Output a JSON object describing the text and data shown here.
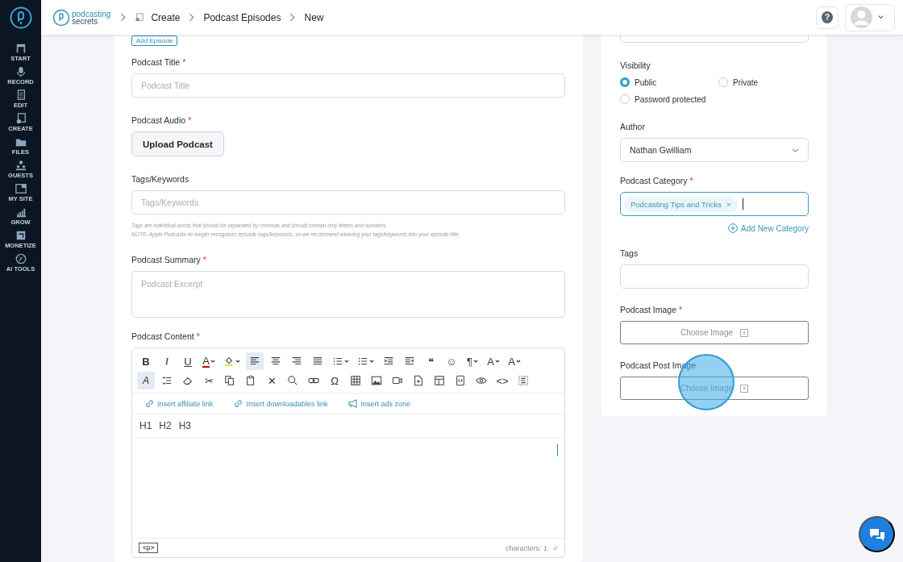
{
  "sidebar": {
    "items": [
      {
        "label": "START",
        "selected": false
      },
      {
        "label": "RECORD",
        "selected": false
      },
      {
        "label": "EDIT",
        "selected": false
      },
      {
        "label": "CREATE",
        "selected": false
      },
      {
        "label": "FILES",
        "selected": false
      },
      {
        "label": "GUESTS",
        "selected": false
      },
      {
        "label": "MY SITE",
        "selected": false
      },
      {
        "label": "GROW",
        "selected": false
      },
      {
        "label": "MONETIZE",
        "selected": false
      },
      {
        "label": "AI TOOLS",
        "selected": false
      }
    ]
  },
  "header": {
    "logo_lines": [
      "podcasting",
      "secrets"
    ],
    "breadcrumb": [
      "Create",
      "Podcast Episodes",
      "New"
    ],
    "help": "?"
  },
  "form": {
    "add_episode": "Add Episode",
    "fields": [
      {
        "kind": "input",
        "label": "Podcast Title",
        "required_mark": "*",
        "placeholder": "Podcast Title"
      },
      {
        "kind": "upload",
        "label": "Podcast Audio",
        "required_mark": "*",
        "button": "Upload Podcast"
      },
      {
        "kind": "input",
        "label": "Tags/Keywords",
        "placeholder": "Tags/Keywords",
        "hints": [
          "Tags are individual words that should be separated by commas and should contain only letters and numbers.",
          "NOTE: Apple Podcasts no longer recognizes episode tags/keywords, so we recommend weaving your tags/keywords into your episode title."
        ]
      },
      {
        "kind": "textarea",
        "label": "Podcast Summary",
        "required_mark": "*",
        "placeholder": "Podcast Excerpt"
      },
      {
        "kind": "editor",
        "label": "Podcast Content",
        "required_mark": "*"
      }
    ]
  },
  "editor": {
    "toolbar": [
      [
        {
          "kind": "bold",
          "glyph": "B",
          "selected": false
        },
        {
          "kind": "italic",
          "glyph": "I",
          "selected": false
        },
        {
          "kind": "underline",
          "glyph": "U",
          "selected": false
        },
        {
          "kind": "font-color",
          "glyph": "A",
          "selected": false,
          "dropdown": true
        },
        {
          "kind": "highlight",
          "selected": false,
          "dropdown": true
        },
        {
          "kind": "align-left",
          "selected": true
        },
        {
          "kind": "align-center",
          "selected": false
        },
        {
          "kind": "align-right",
          "selected": false
        },
        {
          "kind": "justify",
          "selected": false
        },
        {
          "kind": "ordered-list",
          "selected": false,
          "dropdown": true
        },
        {
          "kind": "bullet-list",
          "selected": false,
          "dropdown": true
        },
        {
          "kind": "outdent",
          "selected": false
        },
        {
          "kind": "indent",
          "selected": false
        },
        {
          "kind": "text",
          "glyph": "❝",
          "selected": false
        },
        {
          "kind": "text",
          "glyph": "☺",
          "selected": false
        },
        {
          "kind": "text",
          "glyph": "¶",
          "selected": false,
          "dropdown": true
        },
        {
          "kind": "text",
          "glyph": "A",
          "selected": false,
          "dropdown": true
        },
        {
          "kind": "text",
          "glyph": "A",
          "selected": false,
          "dropdown": true
        }
      ],
      [
        {
          "kind": "font-style",
          "glyph": "A",
          "selected": true
        },
        {
          "kind": "line-height",
          "selected": false
        },
        {
          "kind": "eraser",
          "selected": false
        },
        {
          "kind": "text",
          "glyph": "✂",
          "selected": false
        },
        {
          "kind": "copy",
          "selected": false
        },
        {
          "kind": "paste",
          "selected": false
        },
        {
          "kind": "text",
          "glyph": "✕",
          "selected": false
        },
        {
          "kind": "search",
          "selected": false
        },
        {
          "kind": "link",
          "selected": false
        },
        {
          "kind": "text",
          "glyph": "Ω",
          "selected": false
        },
        {
          "kind": "table",
          "selected": false
        },
        {
          "kind": "image",
          "selected": false
        },
        {
          "kind": "video",
          "selected": false
        },
        {
          "kind": "file",
          "selected": false
        },
        {
          "kind": "template",
          "selected": false
        },
        {
          "kind": "code-block",
          "selected": false
        },
        {
          "kind": "eye",
          "selected": false
        },
        {
          "kind": "text",
          "glyph": "<>",
          "selected": false
        },
        {
          "kind": "select-all",
          "selected": false
        }
      ]
    ],
    "links": [
      {
        "kind": "link",
        "label": "Insert affiliate link"
      },
      {
        "kind": "link",
        "label": "Insert downloadables link"
      },
      {
        "kind": "megaphone",
        "label": "Insert ads zone"
      }
    ],
    "headings": [
      "H1",
      "H2",
      "H3"
    ],
    "path": "<p>",
    "count": "characters: 1"
  },
  "side": {
    "visibility": {
      "label": "Visibility",
      "options": [
        {
          "label": "Public",
          "selected": true
        },
        {
          "label": "Private",
          "selected": false
        },
        {
          "label": "Password protected",
          "selected": false
        }
      ]
    },
    "author": {
      "label": "Author",
      "value": "Nathan Gwilliam"
    },
    "category": {
      "label": "Podcast Category",
      "required_mark": "*",
      "chips": [
        {
          "label": "Podcasting Tips and Tricks",
          "remove": "×"
        }
      ],
      "add": "Add New Category"
    },
    "tags": {
      "label": "Tags"
    },
    "images": [
      {
        "label": "Podcast Image",
        "required_mark": "*",
        "button": "Choose Image"
      },
      {
        "label": "Podcast Post Image",
        "button": "Choose Image"
      }
    ]
  }
}
